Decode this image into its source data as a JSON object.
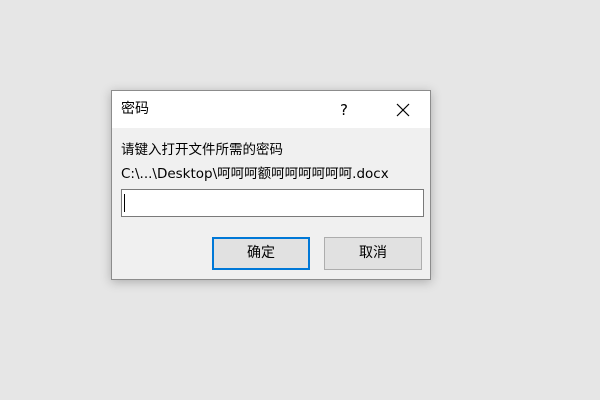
{
  "dialog": {
    "title": "密码",
    "help_label": "?",
    "prompt": "请键入打开文件所需的密码",
    "file_path": "C:\\...\\Desktop\\呵呵呵额呵呵呵呵呵呵.docx",
    "password_value": "",
    "ok_label": "确定",
    "cancel_label": "取消"
  },
  "icons": {
    "close": "close-icon"
  },
  "colors": {
    "accent": "#0078d7",
    "background": "#e6e6e6",
    "dialog_bg": "#f0f0f0"
  }
}
